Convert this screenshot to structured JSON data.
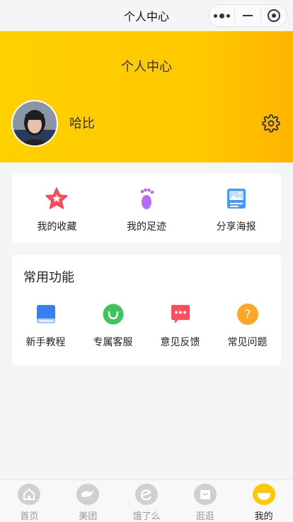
{
  "nav": {
    "title": "个人中心"
  },
  "header": {
    "title": "个人中心",
    "username": "哈比"
  },
  "quick": [
    {
      "label": "我的收藏",
      "icon": "star-icon"
    },
    {
      "label": "我的足迹",
      "icon": "footprint-icon"
    },
    {
      "label": "分享海报",
      "icon": "poster-icon"
    }
  ],
  "common": {
    "title": "常用功能",
    "items": [
      {
        "label": "新手教程",
        "icon": "book-icon"
      },
      {
        "label": "专属客服",
        "icon": "chat-icon"
      },
      {
        "label": "意见反馈",
        "icon": "feedback-icon"
      },
      {
        "label": "常见问题",
        "icon": "question-icon"
      }
    ]
  },
  "tabs": [
    {
      "label": "首页",
      "icon": "home-icon"
    },
    {
      "label": "美团",
      "icon": "meituan-icon"
    },
    {
      "label": "饿了么",
      "icon": "eleme-icon"
    },
    {
      "label": "逛逛",
      "icon": "shop-icon"
    },
    {
      "label": "我的",
      "icon": "profile-icon",
      "active": true
    }
  ],
  "colors": {
    "accent": "#ffc800",
    "accent_end": "#ffb400"
  }
}
